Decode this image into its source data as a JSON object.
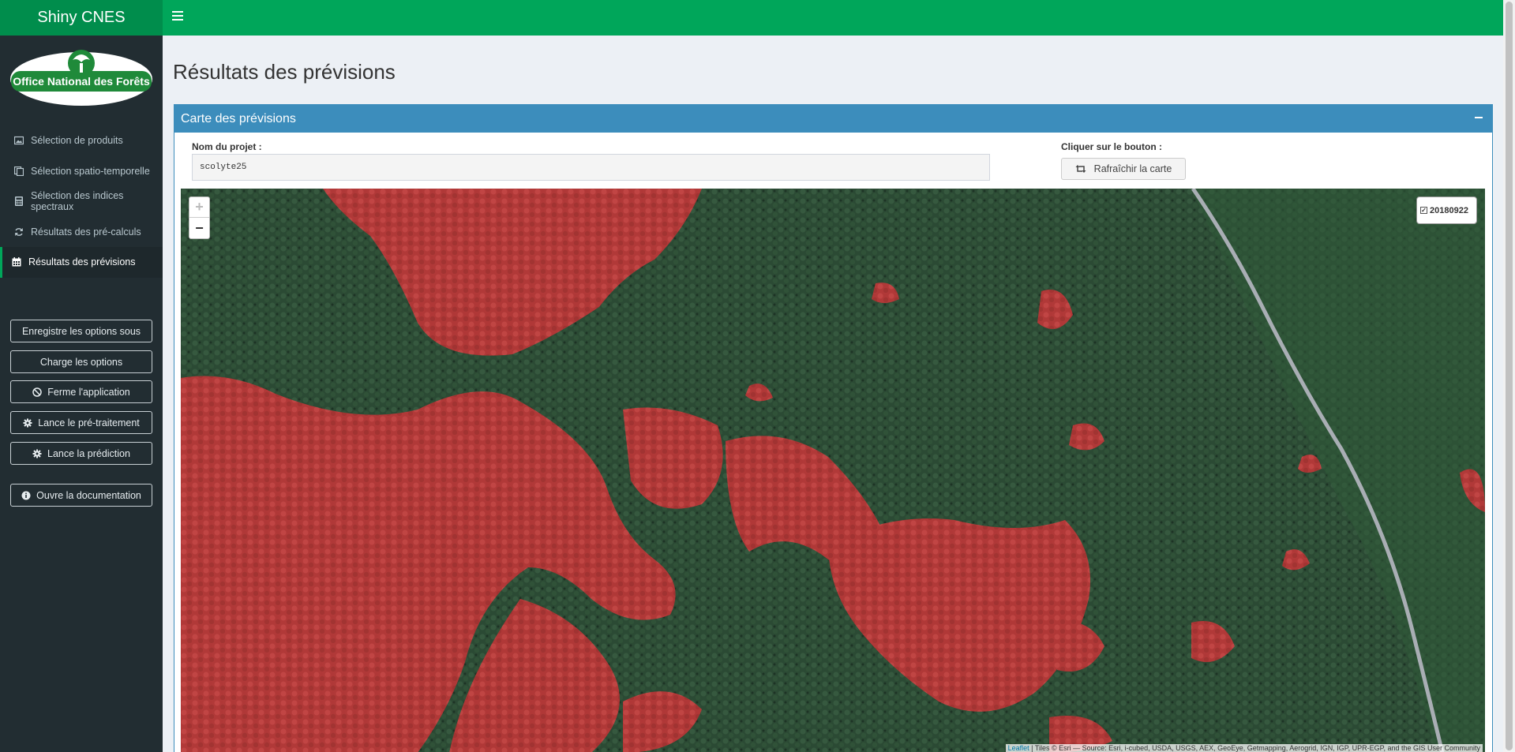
{
  "app": {
    "title": "Shiny CNES"
  },
  "logo": {
    "text": "Office National des Forêts",
    "color": "#1f8a3a"
  },
  "sidebar": {
    "items": [
      {
        "label": "Sélection de produits",
        "icon": "image-icon"
      },
      {
        "label": "Sélection spatio-temporelle",
        "icon": "copy-icon"
      },
      {
        "label": "Sélection des indices spectraux",
        "icon": "calculator-icon"
      },
      {
        "label": "Résultats des pré-calculs",
        "icon": "refresh-icon"
      },
      {
        "label": "Résultats des prévisions",
        "icon": "calendar-icon",
        "active": true
      }
    ],
    "buttons": {
      "save": "Enregistre les options sous",
      "load": "Charge les options",
      "close": "Ferme l'application",
      "preprocess": "Lance le pré-traitement",
      "predict": "Lance la prédiction",
      "docs": "Ouvre la documentation"
    }
  },
  "page": {
    "title": "Résultats des prévisions"
  },
  "box": {
    "title": "Carte des prévisions",
    "project_label": "Nom du projet :",
    "project_value": "scolyte25",
    "button_hint": "Cliquer sur le bouton :",
    "refresh_label": "Rafraîchir la carte"
  },
  "map": {
    "zoom_in": "+",
    "zoom_out": "−",
    "layer_label": "20180922",
    "layer_checked": true,
    "attribution_link": "Leaflet",
    "attribution_text": " | Tiles © Esri — Source: Esri, i-cubed, USDA, USGS, AEX, GeoEye, Getmapping, Aerogrid, IGN, IGP, UPR-EGP, and the GIS User Community"
  },
  "colors": {
    "header": "#00a65a",
    "header_dark": "#008d4c",
    "sidebar": "#222d32",
    "box": "#3c8dbc",
    "prediction": "#c43c3c"
  }
}
